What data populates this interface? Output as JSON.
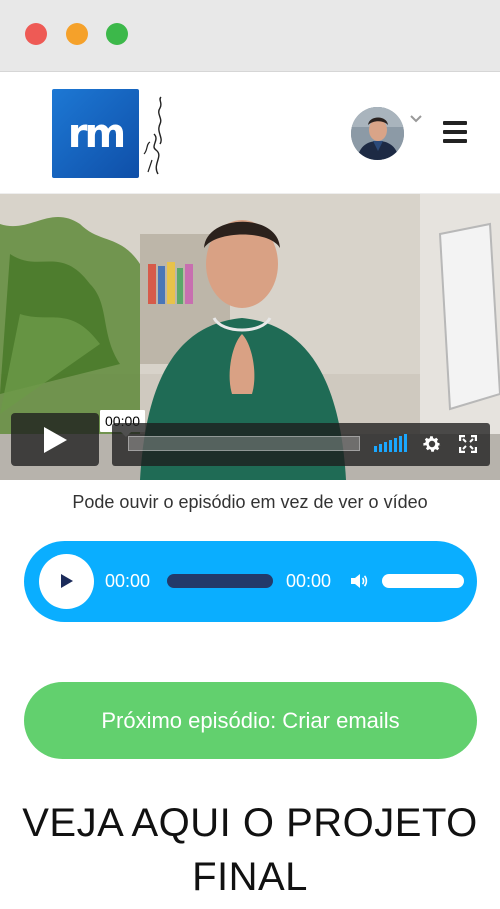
{
  "window": {
    "controls": [
      "close",
      "minimize",
      "maximize"
    ]
  },
  "header": {
    "logo_text": "rm",
    "logo_signature": "Ricardo Martins",
    "avatar_icon": "user-avatar",
    "dropdown_icon": "chevron-down-icon",
    "menu_icon": "hamburger-menu-icon"
  },
  "video": {
    "time_tooltip": "00:00",
    "progress": 0.0,
    "icons": [
      "play-icon",
      "volume-icon",
      "gear-icon",
      "fullscreen-icon"
    ]
  },
  "caption": "Pode ouvir o episódio em vez de ver o vídeo",
  "audio": {
    "current_time": "00:00",
    "duration": "00:00",
    "progress": 0.0,
    "volume": 1.0,
    "accent": "#0aaeff"
  },
  "next_button": {
    "label": "Próximo episódio: Criar emails",
    "color": "#62d06e"
  },
  "heading": "VEJA AQUI O PROJETO FINAL"
}
